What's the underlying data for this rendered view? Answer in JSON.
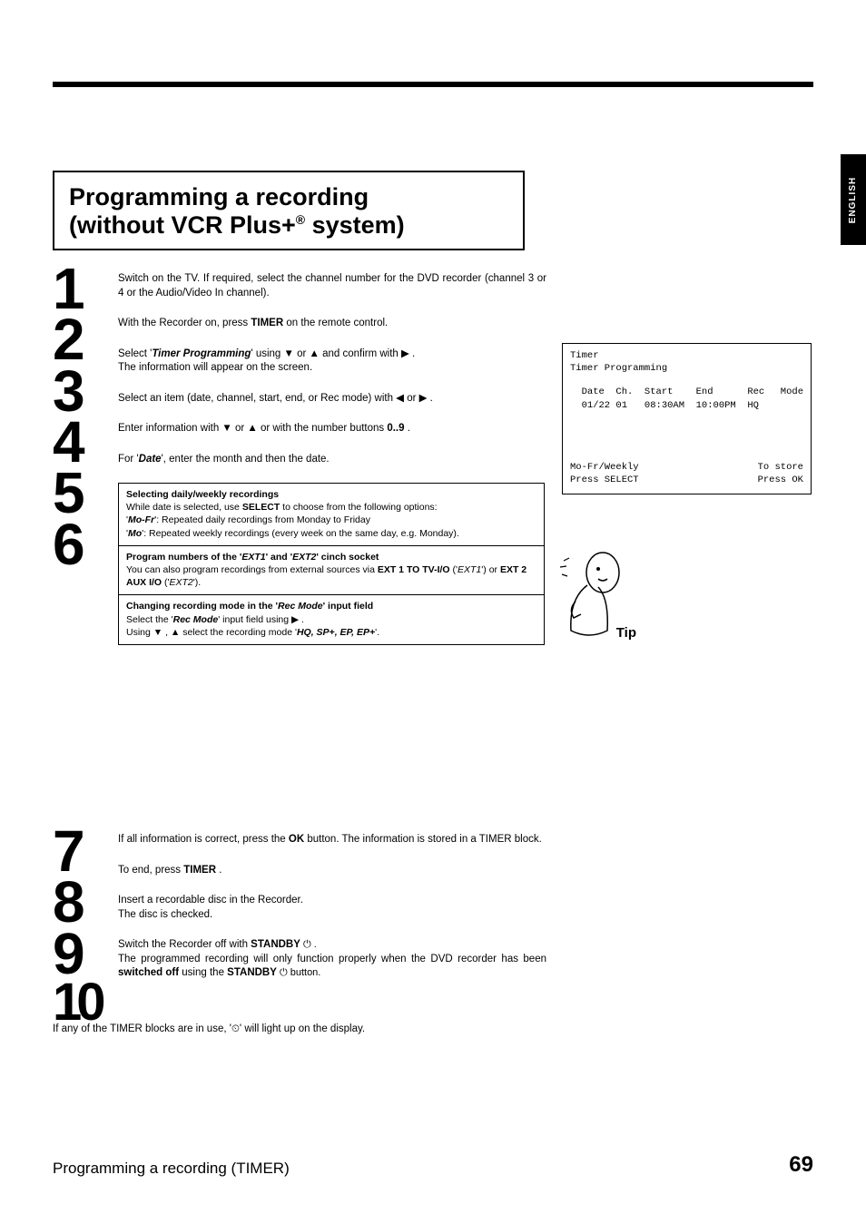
{
  "sideTab": "ENGLISH",
  "title": {
    "line1": "Programming a recording",
    "line2a": "(without VCR Plus+",
    "line2b": " system)"
  },
  "steps_top": [
    {
      "n": "1",
      "text": "Switch on the TV. If required, select the channel number for the DVD recorder (channel 3 or 4 or the Audio/Video In channel)."
    },
    {
      "n": "2",
      "text": "With the Recorder on, press  TIMER on the remote control."
    },
    {
      "n": "3",
      "text_pre": "Select '",
      "bold": "Timer Programming",
      "text_mid": "' using  ▼  or  ▲  and confirm with ▶ .",
      "extra": "The information will appear on the screen."
    },
    {
      "n": "4",
      "text": "Select an item (date, channel, start, end, or Rec mode) with ◀  or  ▶ ."
    },
    {
      "n": "5",
      "text_pre": "Enter information with  ▼  or  ▲  or with the number buttons ",
      "bold": "0..9",
      "text_after": " ."
    },
    {
      "n": "6",
      "text_pre": "For '",
      "bold": "Date",
      "text_after": "', enter the month and then the date."
    }
  ],
  "tip": {
    "label": "Tip",
    "section1": {
      "head": "Selecting daily/weekly recordings",
      "body1": "While date is selected, use  ",
      "sel": "SELECT",
      "body2": " to choose from the following options:",
      "mofr_lbl": "Mo-Fr",
      "mofr_txt": "': Repeated daily recordings from Monday to Friday",
      "mo_lbl": "Mo",
      "mo_txt": "': Repeated weekly recordings (every week on the same day, e.g. Monday)."
    },
    "section2": {
      "head_pre": "Program numbers of the '",
      "ext1": "EXT1",
      "mid": "' and '",
      "ext2": "EXT2",
      "head_post": "' cinch socket",
      "body1": "You can also program recordings from external sources via  ",
      "e1": "EXT 1 TO TV-I/O",
      "paren1_pre": " ('",
      "p1": "EXT1",
      "paren_mid": "')  or  ",
      "e2": "EXT 2 AUX I/O",
      "paren2_pre": " ('",
      "p2": "EXT2",
      "paren_post": "')."
    },
    "section3": {
      "head_pre": "Changing recording mode in the '",
      "rm": "Rec Mode",
      "head_post": "' input field",
      "body_pre": "Select the '",
      "body_rm": "Rec Mode",
      "body_mid": "' input field using  ▶ .",
      "line2_pre": "Using  ▼ ,  ▲  select the recording mode '",
      "modes": "HQ, SP+, EP, EP+",
      "line2_post": "'."
    }
  },
  "osd": {
    "title": "Timer",
    "subtitle": "  Timer Programming",
    "hdr": "  Date  Ch.  Start    End      Rec",
    "hdr2": "                               Mode",
    "row": "  01/22 01   08:30AM  10:00PM  HQ",
    "footer_left": "Mo-Fr/Weekly",
    "footer_right": "To store",
    "footer2_left": "Press SELECT",
    "footer2_right": "Press OK"
  },
  "steps_bottom": [
    {
      "n": "7",
      "pre": "If all information is correct, press the  ",
      "b": "OK",
      "post": " button. The information is stored in a TIMER block."
    },
    {
      "n": "8",
      "pre": "To end, press  ",
      "b": "TIMER",
      "post": " ."
    },
    {
      "n": "9",
      "pre": "Insert a recordable disc in the Recorder.",
      "extra": "The disc is checked."
    },
    {
      "n": "10",
      "pre": "Switch the Recorder off with  ",
      "b": "STANDBY",
      "icon": " ⏻ .",
      "line2_pre": "The programmed recording will only function properly when the DVD recorder has been ",
      "line2_b": "switched off",
      "line2_mid": " using the ",
      "line2_b2": "STANDBY",
      "line2_post": " ⏻ button."
    }
  ],
  "closing_pre": "If any of the TIMER blocks are in use, '",
  "closing_icon": "⏲",
  "closing_post": "' will light up on the display.",
  "footer": "Programming a recording (TIMER)",
  "page": "69"
}
